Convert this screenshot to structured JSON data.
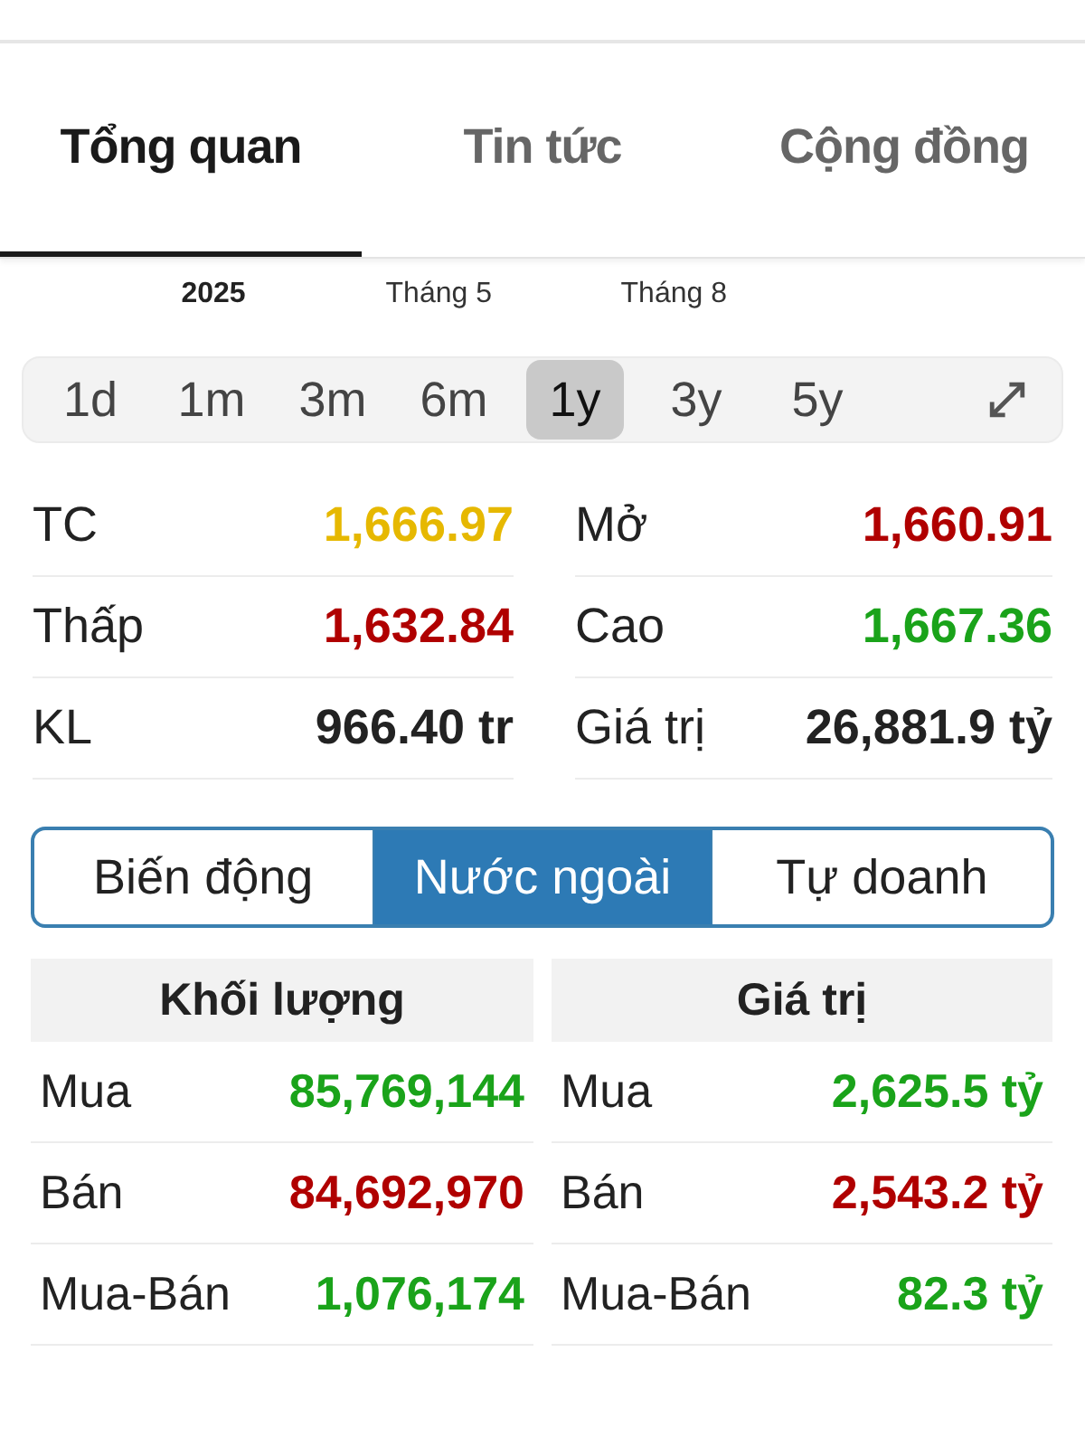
{
  "tabs": [
    {
      "label": "Tổng quan",
      "selected": true
    },
    {
      "label": "Tin tức",
      "selected": false
    },
    {
      "label": "Cộng đồng",
      "selected": false
    }
  ],
  "axis_labels": [
    {
      "text": "2025",
      "kind": "year"
    },
    {
      "text": "Tháng 5",
      "kind": "month"
    },
    {
      "text": "Tháng 8",
      "kind": "month"
    }
  ],
  "ranges": [
    {
      "label": "1d",
      "selected": false
    },
    {
      "label": "1m",
      "selected": false
    },
    {
      "label": "3m",
      "selected": false
    },
    {
      "label": "6m",
      "selected": false
    },
    {
      "label": "1y",
      "selected": true
    },
    {
      "label": "3y",
      "selected": false
    },
    {
      "label": "5y",
      "selected": false
    }
  ],
  "stats": [
    {
      "label": "TC",
      "value": "1,666.97",
      "color": "#e6b800"
    },
    {
      "label": "Mở",
      "value": "1,660.91",
      "color": "#b00000"
    },
    {
      "label": "Thấp",
      "value": "1,632.84",
      "color": "#b00000"
    },
    {
      "label": "Cao",
      "value": "1,667.36",
      "color": "#1aa31a"
    },
    {
      "label": "KL",
      "value": "966.40 tr",
      "color": "#222222"
    },
    {
      "label": "Giá trị",
      "value": "26,881.9 tỷ",
      "color": "#222222"
    }
  ],
  "segments": [
    {
      "label": "Biến động",
      "selected": false
    },
    {
      "label": "Nước ngoài",
      "selected": true
    },
    {
      "label": "Tự doanh",
      "selected": false
    }
  ],
  "tables": [
    {
      "title": "Khối lượng",
      "rows": [
        {
          "label": "Mua",
          "value": "85,769,144",
          "color": "#1aa31a"
        },
        {
          "label": "Bán",
          "value": "84,692,970",
          "color": "#b00000"
        },
        {
          "label": "Mua-Bán",
          "value": "1,076,174",
          "color": "#1aa31a"
        }
      ]
    },
    {
      "title": "Giá trị",
      "rows": [
        {
          "label": "Mua",
          "value": "2,625.5 tỷ",
          "color": "#1aa31a"
        },
        {
          "label": "Bán",
          "value": "2,543.2 tỷ",
          "color": "#b00000"
        },
        {
          "label": "Mua-Bán",
          "value": "82.3 tỷ",
          "color": "#1aa31a"
        }
      ]
    }
  ]
}
